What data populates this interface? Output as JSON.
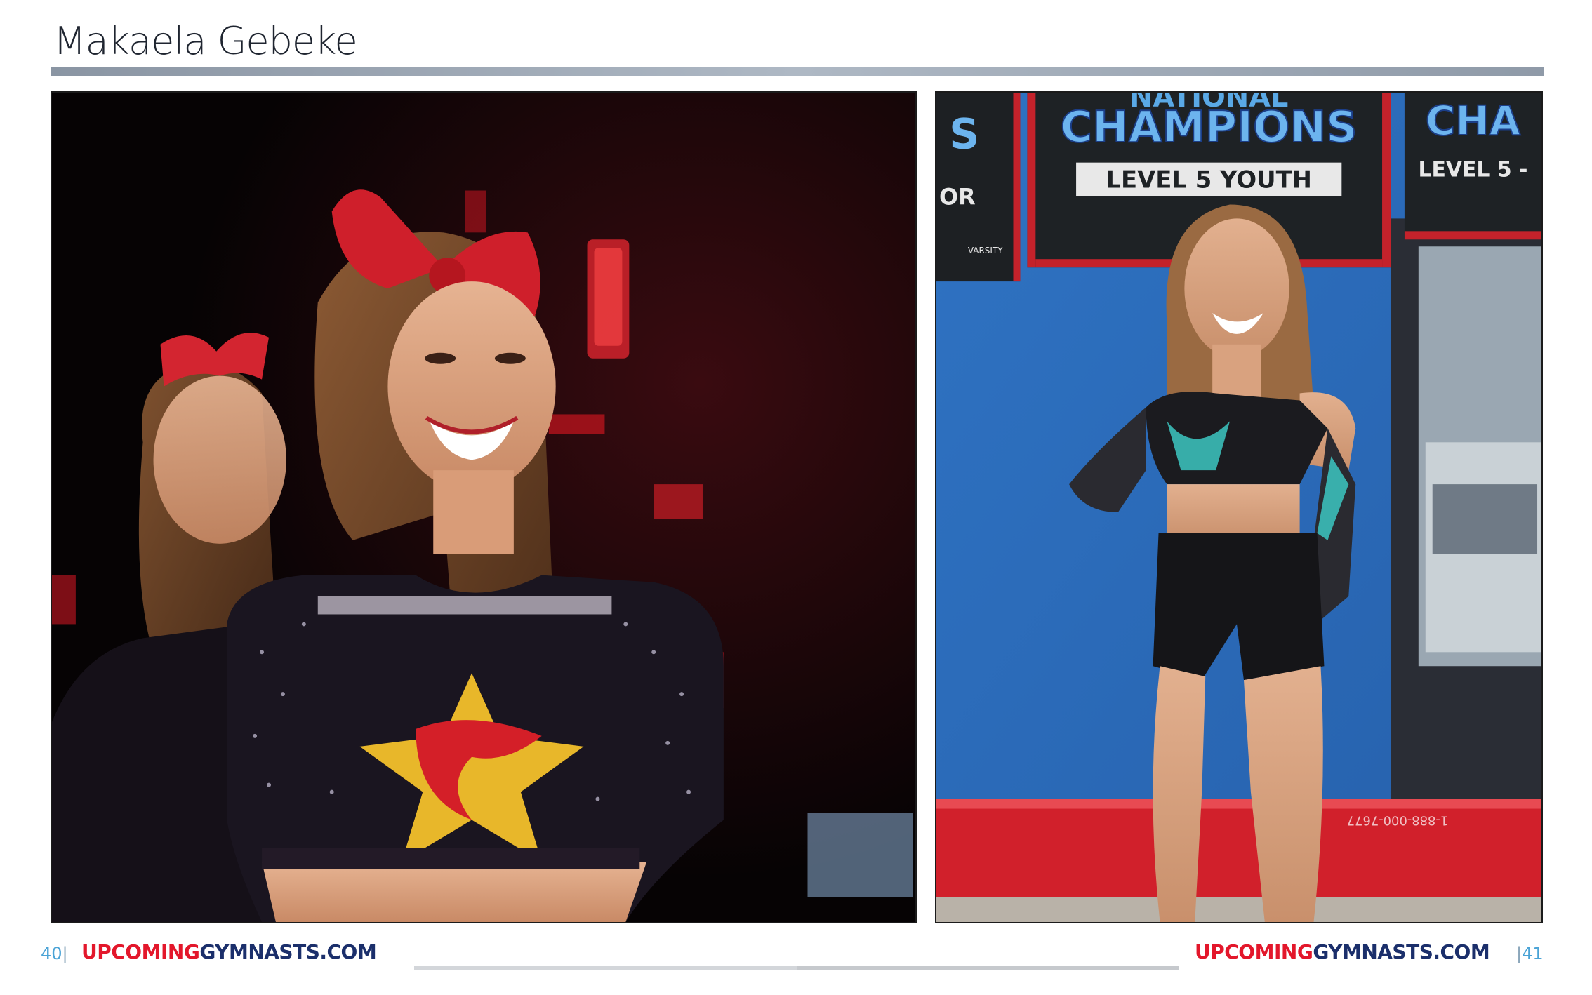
{
  "header": {
    "title": "Makaela Gebeke"
  },
  "photos": {
    "left": {
      "icon": "cheer-athlete-stage-photo"
    },
    "right": {
      "icon": "cheer-athlete-gym-photo",
      "banners": {
        "top_partial": "NATIONAL",
        "center_title": "CHAMPIONS",
        "center_sub": "LEVEL 5 YOUTH",
        "right_title": "CHA",
        "right_sub": "LEVEL 5 -",
        "left_partial": "S",
        "left_partial_sub": "OR",
        "logo_text": "VARSITY"
      },
      "mat_text": "1-888-000-7677"
    }
  },
  "footer": {
    "left_page": "40",
    "right_page": "41",
    "separator": "|",
    "brand_part1": "UPCOMING",
    "brand_part2": "GYMNASTS.COM"
  },
  "colors": {
    "brand_red": "#e3172b",
    "brand_navy": "#1b2f6b",
    "page_number": "#4aa3d6",
    "title_rule": "#9aa5b2"
  }
}
